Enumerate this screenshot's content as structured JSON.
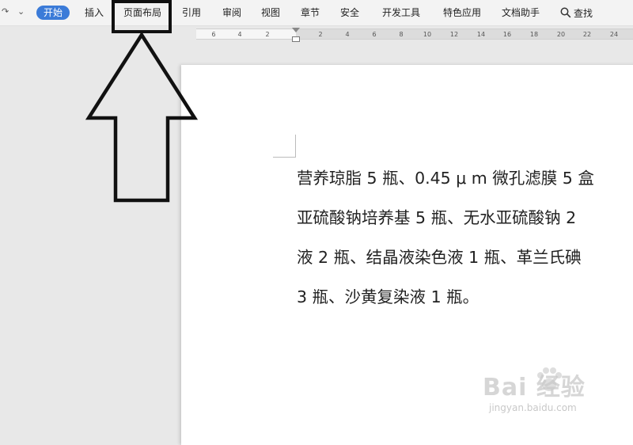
{
  "toolbar": {
    "tabs": [
      {
        "label": "开始"
      },
      {
        "label": "插入"
      },
      {
        "label": "页面布局"
      },
      {
        "label": "引用"
      },
      {
        "label": "审阅"
      },
      {
        "label": "视图"
      },
      {
        "label": "章节"
      },
      {
        "label": "安全"
      },
      {
        "label": "开发工具"
      },
      {
        "label": "特色应用"
      },
      {
        "label": "文档助手"
      }
    ],
    "search_label": "查找",
    "active_color": "#3b7bd8"
  },
  "ruler": {
    "ticks": [
      "6",
      "4",
      "2",
      "2",
      "4",
      "6",
      "8",
      "10",
      "12",
      "14",
      "16",
      "18",
      "20",
      "22",
      "24"
    ]
  },
  "document": {
    "lines": [
      "营养琼脂 5 瓶、0.45 μ m 微孔滤膜 5 盒",
      "亚硫酸钠培养基 5 瓶、无水亚硫酸钠 2",
      "液 2 瓶、结晶液染色液 1 瓶、革兰氏碘",
      "3 瓶、沙黄复染液 1 瓶。"
    ]
  },
  "annotation": {
    "highlighted_tab": "页面布局"
  },
  "watermark": {
    "text": "Bai 经验",
    "url": "jingyan.baidu.com"
  }
}
